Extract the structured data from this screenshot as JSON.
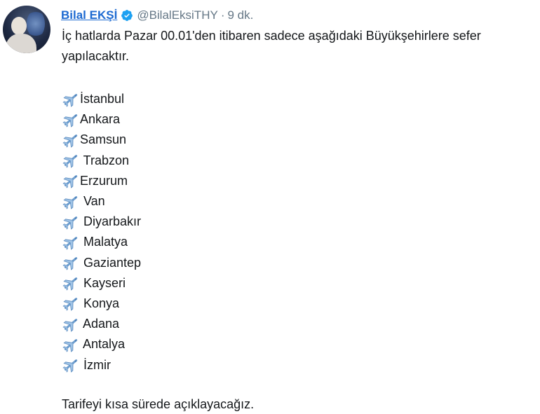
{
  "tweet": {
    "author_name": "Bilal EKŞİ",
    "handle": "@BilalEksiTHY",
    "separator": "·",
    "time": "9 dk.",
    "line1": "İç hatlarda Pazar 00.01'den itibaren  sadece aşağıdaki   Büyükşehirlere sefer",
    "line2": "yapılacaktır.",
    "cities": [
      "İstanbul",
      "Ankara",
      "Samsun",
      " Trabzon",
      "Erzurum",
      " Van",
      " Diyarbakır",
      " Malatya",
      " Gaziantep",
      " Kayseri",
      " Konya",
      " Adana",
      " Antalya",
      " İzmir"
    ],
    "footer": "Tarifeyi kısa sürede açıklayacağız.",
    "list_icon": "airplane-icon",
    "verified_color": "#1da1f2",
    "name_color": "#1d6ad1"
  }
}
